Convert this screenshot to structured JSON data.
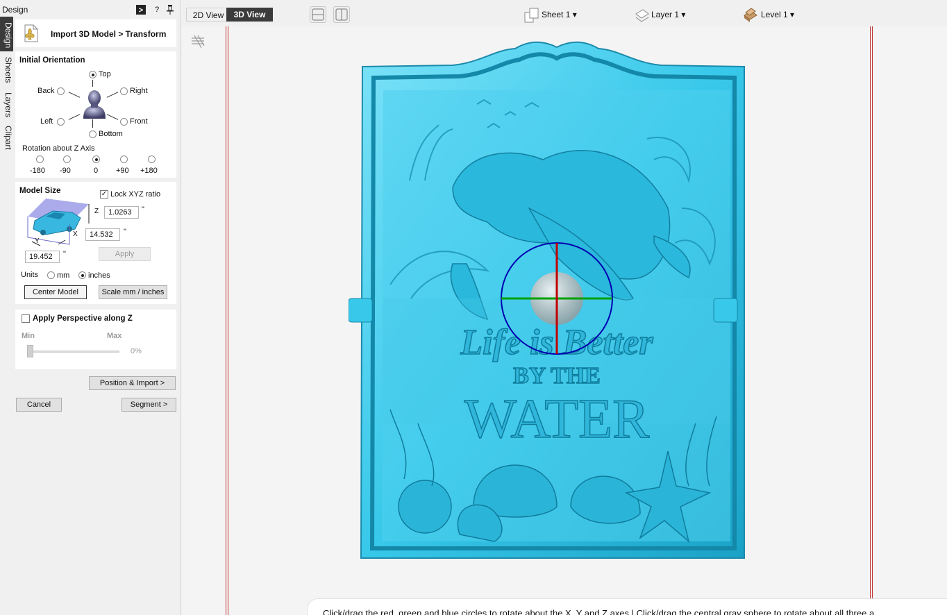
{
  "panel": {
    "title": "Design",
    "dock_icon": "dock-icon",
    "help_label": "?",
    "pin_icon": "pin-icon",
    "side_tabs": [
      "Design",
      "Sheets",
      "Layers",
      "Clipart"
    ],
    "heading": "Import 3D Model > Transform"
  },
  "orientation": {
    "title": "Initial Orientation",
    "options": {
      "top": "Top",
      "back": "Back",
      "right": "Right",
      "left": "Left",
      "front": "Front",
      "bottom": "Bottom"
    },
    "selected": "Top",
    "rotation_title": "Rotation about Z Axis",
    "rotation_options": [
      "-180",
      "-90",
      "0",
      "+90",
      "+180"
    ],
    "rotation_selected": "0"
  },
  "model_size": {
    "title": "Model Size",
    "lock_label": "Lock XYZ ratio",
    "lock_checked": true,
    "z_label": "Z",
    "x_label": "X",
    "y_label": "Y",
    "z_value": "1.0263",
    "x_value": "14.532",
    "y_value": "19.452",
    "unit_symbol": "\"",
    "apply_label": "Apply",
    "units_label": "Units",
    "unit_mm": "mm",
    "unit_inches": "inches",
    "unit_selected": "inches",
    "center_model": "Center Model",
    "scale_mm_inches": "Scale mm / inches"
  },
  "perspective": {
    "label": "Apply Perspective along Z",
    "checked": false,
    "min_label": "Min",
    "max_label": "Max",
    "value_text": "0%",
    "value": 0
  },
  "actions": {
    "position_import": "Position & Import >",
    "cancel": "Cancel",
    "segment": "Segment >"
  },
  "toolbar": {
    "tab_2d": "2D View",
    "tab_3d": "3D View",
    "active_tab": "3D View",
    "sheet": "Sheet 1",
    "layer": "Layer 1",
    "level": "Level 1"
  },
  "viewport": {
    "plaque_text_1": "Life is Better",
    "plaque_text_2": "BY THE",
    "plaque_text_3": "WATER",
    "hint": "Click/drag the red, green and blue circles to rotate about the X, Y and Z axes | Click/drag the central gray sphere to rotate about all three a",
    "relief_color": "#38c8ea",
    "gizmo_x_color": "#c00000",
    "gizmo_y_color": "#00a000",
    "gizmo_z_color": "#0000b0"
  }
}
